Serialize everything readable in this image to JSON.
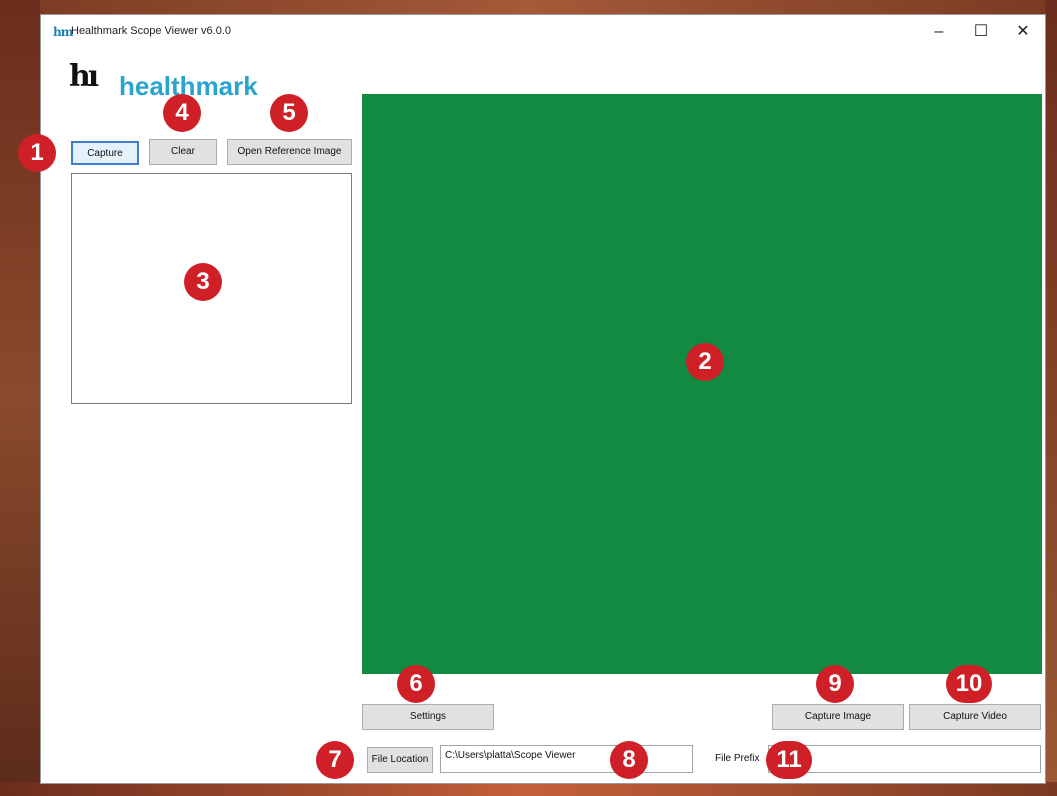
{
  "window": {
    "title": "Healthmark Scope Viewer v6.0.0",
    "app_icon": "hm",
    "minimize": "–",
    "maximize": "☐",
    "close": "✕"
  },
  "logo": {
    "mark": "hı",
    "text": "healthmark"
  },
  "toolbar": {
    "capture_label": "Capture",
    "clear_label": "Clear",
    "open_reference_label": "Open Reference Image"
  },
  "bottom": {
    "settings_label": "Settings",
    "capture_image_label": "Capture Image",
    "capture_video_label": "Capture Video",
    "file_location_label": "File Location",
    "file_location_value": "C:\\Users\\platta\\Scope Viewer",
    "file_prefix_label": "File Prefix",
    "file_prefix_value": ""
  },
  "callouts": [
    "1",
    "2",
    "3",
    "4",
    "5",
    "6",
    "7",
    "8",
    "9",
    "10",
    "11"
  ],
  "colors": {
    "video_background": "#128a42",
    "callout": "#cf2027",
    "logo_text": "#2aa3cf",
    "focus_border": "#3c7fd0"
  }
}
